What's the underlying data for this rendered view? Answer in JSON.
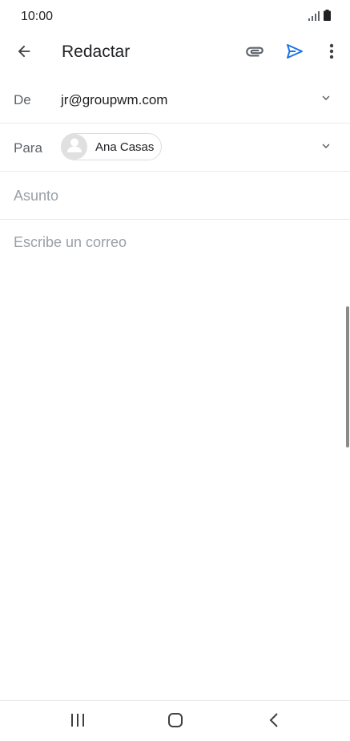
{
  "status_bar": {
    "time": "10:00",
    "icons": [
      "signal-icon",
      "battery-icon"
    ]
  },
  "app_bar": {
    "title": "Redactar",
    "icons": {
      "back": "arrow-back-icon",
      "attach": "paperclip-icon",
      "send": "send-icon",
      "more": "more-vertical-icon"
    },
    "send_color": "#1a73e8"
  },
  "compose": {
    "from": {
      "label": "De",
      "value": "jr@groupwm.com"
    },
    "to": {
      "label": "Para",
      "recipients": [
        {
          "name": "Ana Casas"
        }
      ]
    },
    "subject": {
      "placeholder": "Asunto",
      "value": ""
    },
    "body": {
      "placeholder": "Escribe un correo",
      "value": ""
    }
  },
  "nav_bar": {
    "icons": [
      "recents-icon",
      "home-icon",
      "back-icon"
    ]
  }
}
